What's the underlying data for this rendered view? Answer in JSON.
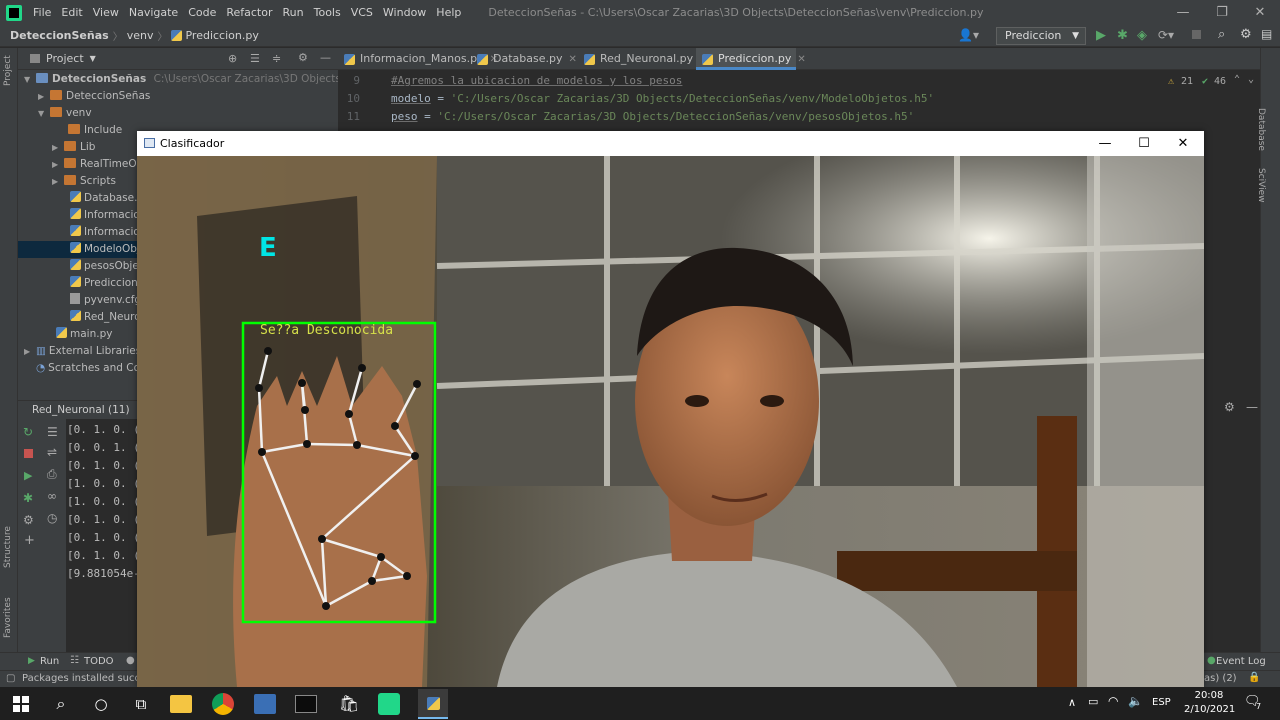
{
  "ide": {
    "menu": [
      "File",
      "Edit",
      "View",
      "Navigate",
      "Code",
      "Refactor",
      "Run",
      "Tools",
      "VCS",
      "Window",
      "Help"
    ],
    "title": "DeteccionSeñas - C:\\Users\\Oscar Zacarias\\3D Objects\\DeteccionSeñas\\venv\\Prediccion.py",
    "breadcrumb": [
      "DeteccionSeñas",
      "venv",
      "Prediccion.py"
    ],
    "run_config": "Prediccion",
    "project_label": "Project",
    "tree": [
      {
        "label": "DeteccionSeñas",
        "extra": "C:\\Users\\Oscar Zacarias\\3D Objects\\Deteccion",
        "icon": "folder-icon"
      },
      {
        "label": "DeteccionSeñas",
        "icon": "folder-icon"
      },
      {
        "label": "venv",
        "icon": "folder-icon"
      },
      {
        "label": "Include",
        "icon": "folder-icon"
      },
      {
        "label": "Lib",
        "icon": "folder-icon"
      },
      {
        "label": "RealTimeOb",
        "icon": "folder-icon"
      },
      {
        "label": "Scripts",
        "icon": "folder-icon"
      },
      {
        "label": "Database.py",
        "icon": "python-file-icon"
      },
      {
        "label": "Informacio",
        "icon": "python-file-icon"
      },
      {
        "label": "Informacio",
        "icon": "python-file-icon"
      },
      {
        "label": "ModeloObje",
        "icon": "python-file-icon"
      },
      {
        "label": "pesosObjet",
        "icon": "python-file-icon"
      },
      {
        "label": "Prediccion.p",
        "icon": "python-file-icon"
      },
      {
        "label": "pyvenv.cfg",
        "icon": "config-file-icon"
      },
      {
        "label": "Red_Neuron",
        "icon": "python-file-icon"
      },
      {
        "label": "main.py",
        "icon": "python-file-icon"
      },
      {
        "label": "External Libraries",
        "icon": "library-icon"
      },
      {
        "label": "Scratches and Con",
        "icon": "scratches-icon"
      }
    ],
    "tabs": [
      "Informacion_Manos.py",
      "Database.py",
      "Red_Neuronal.py",
      "Prediccion.py"
    ],
    "code_lines": [
      {
        "num": "9",
        "text": "#Agremos la ubicacion de modelos y los pesos"
      },
      {
        "num": "10",
        "kw": "modelo",
        "rest": " = ",
        "str": "'C:/Users/Oscar Zacarias/3D Objects/DeteccionSeñas/venv/ModeloObjetos.h5'"
      },
      {
        "num": "11",
        "kw": "peso",
        "rest": " = ",
        "str": "'C:/Users/Oscar Zacarias/3D Objects/DeteccionSeñas/venv/pesosObjetos.h5'"
      }
    ],
    "inspections": {
      "warnings": "21",
      "weak": "46"
    },
    "run_tab": "Red_Neuronal (11)",
    "run_output": [
      "[0. 1. 0. (",
      "[0. 0. 1. (",
      "[0. 1. 0. (",
      "[1. 0. 0. (",
      "[1. 0. 0. (",
      "[0. 1. 0. (",
      "[0. 1. 0. (",
      "[0. 1. 0. (",
      "[9.881054e-"
    ],
    "bottom_tools": [
      "Run",
      "TODO"
    ],
    "event_log": "Event Log",
    "status": "Packages installed success",
    "status_right": "as) (2)",
    "side_labels": {
      "left_top": "Project",
      "structure": "Structure",
      "favorites": "Favorites",
      "right_top": "Database",
      "sciview": "SciView"
    }
  },
  "classifier": {
    "title": "Clasificador",
    "letter": "E",
    "box_label": "Se??a Desconocida",
    "box_color": "#00ff00",
    "letter_color": "#00e5e5"
  },
  "taskbar": {
    "lang": "ESP",
    "time": "20:08",
    "date": "2/10/2021",
    "notifications": "7"
  }
}
